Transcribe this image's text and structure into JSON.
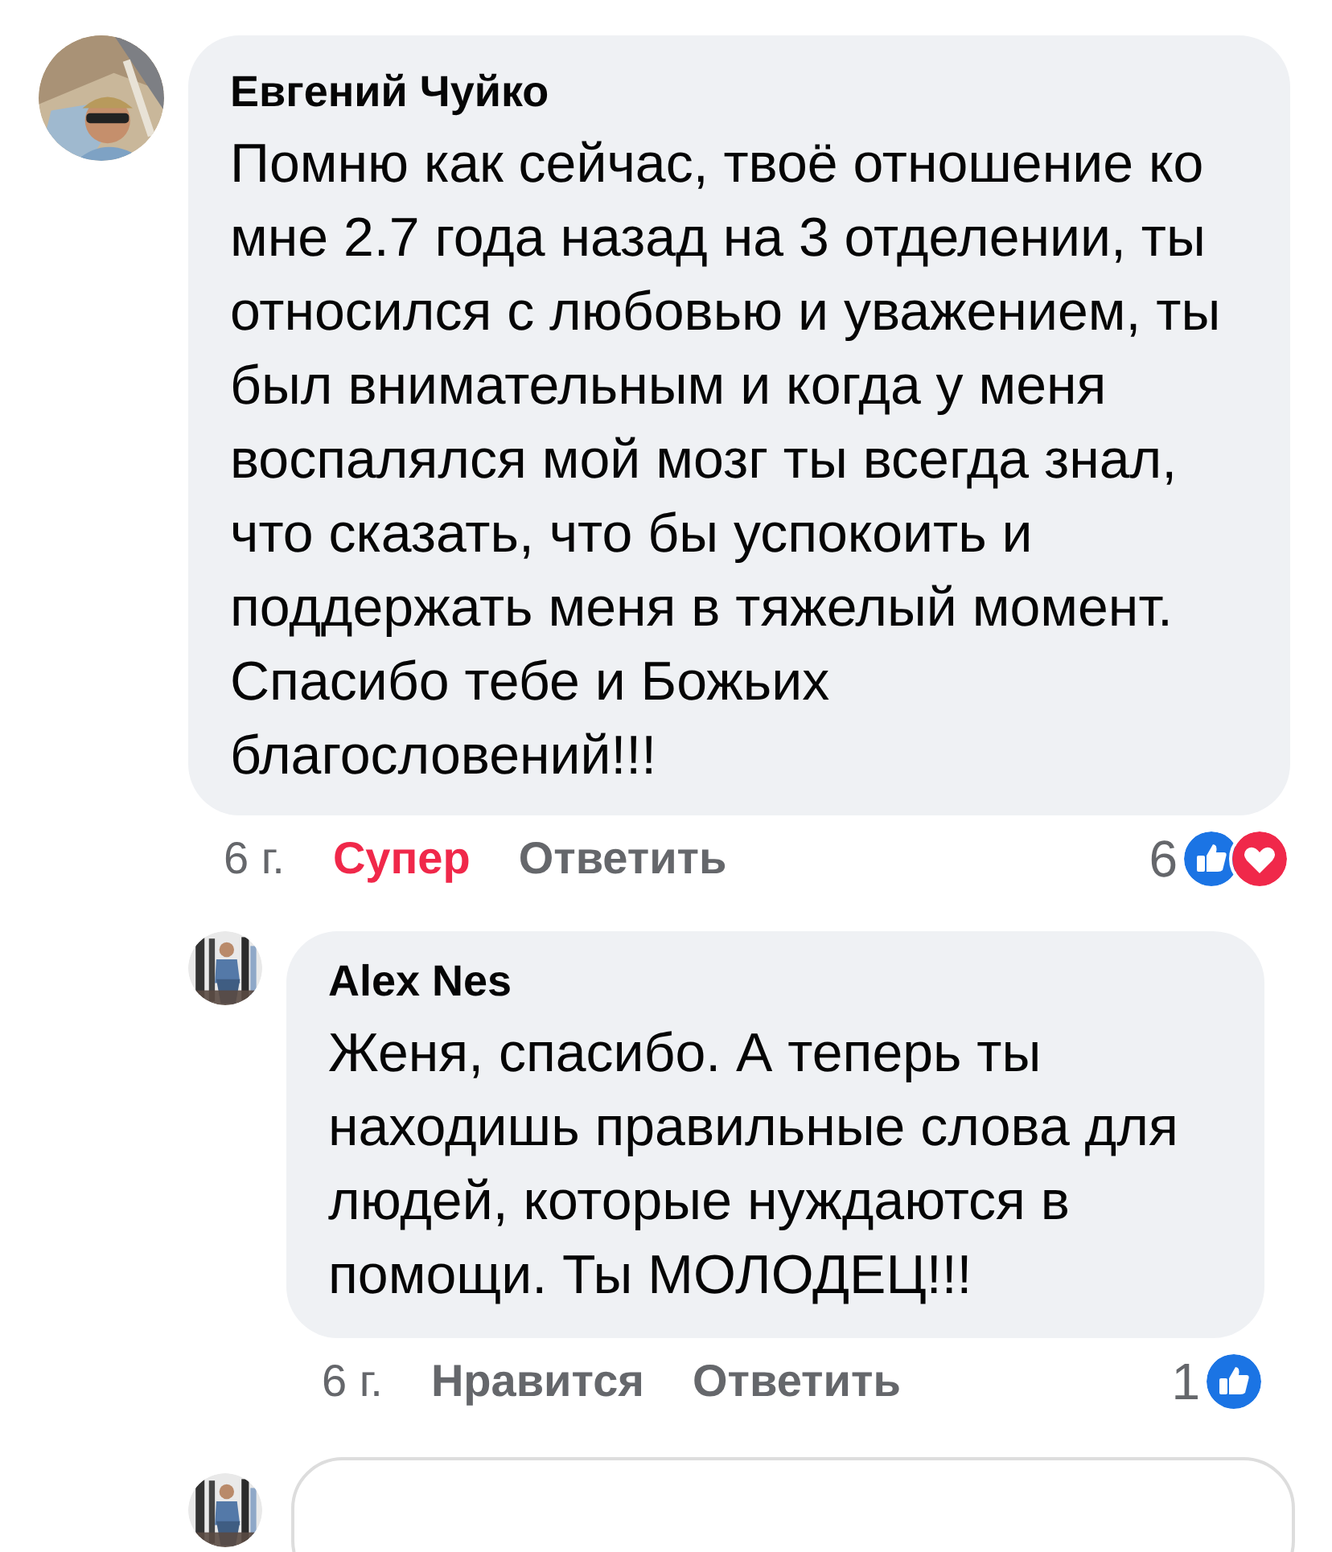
{
  "comments": [
    {
      "author": "Евгений Чуйко",
      "text": "Помню как сейчас, твоё отношение ко мне 2.7 года назад на 3 отделении, ты относился с любовью и уважением, ты был внимательным и когда у меня воспалялся мой мозг ты всегда знал, что сказать, что бы успокоить и поддержать меня в тяжелый момент. Спасибо тебе и Божьих благословений!!!",
      "time": "6 г.",
      "reaction": {
        "label": "Супер",
        "selected": true
      },
      "reply_label": "Ответить",
      "reaction_count": "6",
      "reaction_icons": [
        {
          "kind": "like"
        },
        {
          "kind": "love"
        }
      ],
      "replies": [
        {
          "author": "Alex Nes",
          "text": "Женя, спасибо. А теперь ты находишь правильные слова для людей, которые нуждаются в помощи. Ты МОЛОДЕЦ!!!",
          "time": "6 г.",
          "reaction": {
            "label": "Нравится",
            "selected": false
          },
          "reply_label": "Ответить",
          "reaction_count": "1",
          "reaction_icons": [
            {
              "kind": "like"
            }
          ]
        }
      ]
    }
  ],
  "more_below": true
}
